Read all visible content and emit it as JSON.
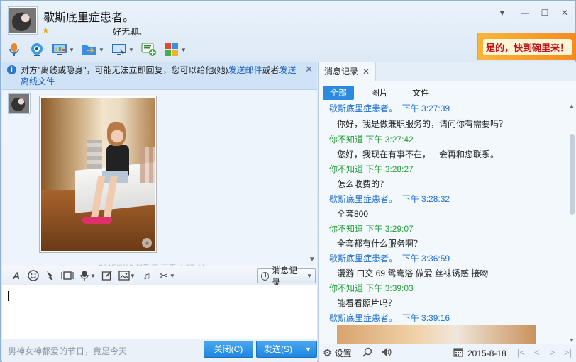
{
  "header": {
    "contact_name": "歇斯底里症患者。",
    "signature": "好无聊。",
    "star_icon": "star-icon"
  },
  "window_controls": {
    "icons": [
      "chevron-down-icon",
      "minimize-icon",
      "maximize-icon",
      "close-icon"
    ]
  },
  "toolbar": {
    "icons": [
      "microphone-icon",
      "video-call-icon",
      "screen-share-icon",
      "file-transfer-icon",
      "remote-desktop-icon",
      "add-app-icon",
      "apps-grid-icon"
    ]
  },
  "ad_banner": {
    "text": "是的，快到碗里来！"
  },
  "notice": {
    "text_prefix": "对方\"离线或隐身\"，可能无法立即回复，您可以给他(她)",
    "link_email": "发送邮件",
    "text_or": "或者",
    "link_offline_file": "发送离线文件"
  },
  "chat": {
    "faded_timestamp": "2015/8/18 星期二 下午 4:27:44"
  },
  "input_toolbar": {
    "icons": [
      "font-icon",
      "emoji-icon",
      "shake-icon",
      "screenshot-video-icon",
      "voice-icon",
      "edit-icon",
      "image-icon",
      "music-icon",
      "scissors-icon"
    ],
    "history_button": "消息记录"
  },
  "bottom": {
    "marquee": "男神女神都爱的节日，竟是今天",
    "close_label": "关闭(C)",
    "send_label": "发送(S)"
  },
  "history_panel": {
    "tab_label": "消息记录",
    "filters": [
      "全部",
      "图片",
      "文件"
    ],
    "messages": [
      {
        "sender": "歇斯底里症患者。",
        "time": "下午 3:27:39",
        "color": "blue",
        "text": "你好，我是做兼职服务的，请问你有需要吗？"
      },
      {
        "sender": "你不知道",
        "time": "下午 3:27:42",
        "color": "green",
        "text": "您好，我现在有事不在，一会再和您联系。"
      },
      {
        "sender": "你不知道",
        "time": "下午 3:28:27",
        "color": "green",
        "text": "怎么收费的？"
      },
      {
        "sender": "歇斯底里症患者。",
        "time": "下午 3:28:32",
        "color": "blue",
        "text": "全套800"
      },
      {
        "sender": "你不知道",
        "time": "下午 3:29:07",
        "color": "green",
        "text": "全套都有什么服务啊？"
      },
      {
        "sender": "歇斯底里症患者。",
        "time": "下午 3:36:59",
        "color": "blue",
        "text": "漫游  口交 69 鸳鸯浴 做爱 丝袜诱惑  接吻"
      },
      {
        "sender": "你不知道",
        "time": "下午 3:39:03",
        "color": "green",
        "text": "能看看照片吗？"
      },
      {
        "sender": "歇斯底里症患者。",
        "time": "下午 3:39:16",
        "color": "blue",
        "text": ""
      }
    ],
    "settings_label": "设置",
    "date": "2015-8-18"
  }
}
